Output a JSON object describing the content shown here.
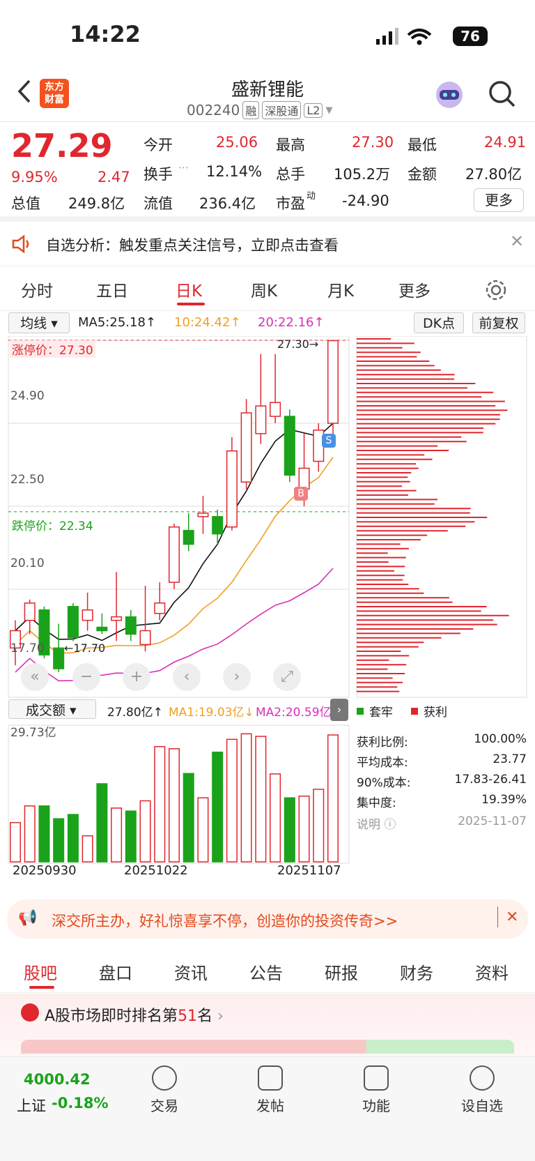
{
  "status": {
    "time": "14:22",
    "battery": "76"
  },
  "header": {
    "title": "盛新锂能",
    "code": "002240",
    "tags": [
      "融",
      "深股通",
      "L2"
    ]
  },
  "quote": {
    "price": "27.29",
    "pct": "9.95%",
    "chg": "2.47",
    "open_l": "今开",
    "open": "25.06",
    "high_l": "最高",
    "high": "27.30",
    "low_l": "最低",
    "low": "24.91",
    "turn_l": "换手",
    "turn": "12.14%",
    "vol_l": "总手",
    "vol": "105.2万",
    "amt_l": "金额",
    "amt": "27.80亿",
    "mcap_l": "总值",
    "mcap": "249.8亿",
    "float_l": "流值",
    "float": "236.4亿",
    "pe_l": "市盈",
    "pe_sup": "动",
    "pe": "-24.90",
    "more": "更多"
  },
  "banner": {
    "text": "自选分析：触发重点关注信号，立即点击查看"
  },
  "tabs": [
    "分时",
    "五日",
    "日K",
    "周K",
    "月K",
    "更多"
  ],
  "toolbar": {
    "ma_sel": "均线",
    "ma5": "MA5:25.18↑",
    "ma10": "10:24.42↑",
    "ma20": "20:22.16↑",
    "dk": "DK点",
    "adj": "前复权"
  },
  "kchart": {
    "y_labels": [
      "27.30",
      "24.90",
      "22.50",
      "20.10",
      "17.70"
    ],
    "limit_up": "涨停价：27.30",
    "limit_down": "跌停价：22.34",
    "high_mark": "27.30→",
    "low_mark": "←17.70",
    "sig_b": "B",
    "sig_s": "S"
  },
  "volbar": {
    "sel": "成交额",
    "cur": "27.80亿↑",
    "ma1": "MA1:19.03亿↓",
    "ma2": "MA2:20.59亿↑",
    "max": "29.73亿",
    "dates": [
      "20250930",
      "20251022",
      "20251107"
    ]
  },
  "chip": {
    "legend1": "套牢",
    "legend2": "获利",
    "rows": [
      {
        "k": "获利比例:",
        "v": "100.00%"
      },
      {
        "k": "平均成本:",
        "v": "23.77"
      },
      {
        "k": "90%成本:",
        "v": "17.83-26.41"
      },
      {
        "k": "集中度:",
        "v": "19.39%"
      }
    ],
    "note": "说明",
    "date": "2025-11-07"
  },
  "promo": {
    "text": "深交所主办，好礼惊喜享不停，创造你的投资传奇>>"
  },
  "btabs": [
    "股吧",
    "盘口",
    "资讯",
    "公告",
    "研报",
    "财务",
    "资料"
  ],
  "rank": {
    "pre": "A股市场即时排名第",
    "num": "51",
    "post": "名"
  },
  "bottom": {
    "index": "4000.42",
    "index_name": "上证",
    "index_chg": "-0.18%",
    "items": [
      "交易",
      "发帖",
      "功能",
      "设自选"
    ]
  },
  "colors": {
    "up": "#e0262f",
    "down": "#1aa31a",
    "ma10": "#f0a020",
    "ma20": "#d92fb8"
  },
  "chart_data": {
    "type": "candlestick",
    "dates_shown": [
      "20250930",
      "20251022",
      "20251107"
    ],
    "candles": [
      {
        "o": 18.4,
        "c": 18.9,
        "h": 19.2,
        "l": 17.9
      },
      {
        "o": 19.2,
        "c": 19.7,
        "h": 19.8,
        "l": 18.8
      },
      {
        "o": 19.5,
        "c": 18.2,
        "h": 19.6,
        "l": 18.1
      },
      {
        "o": 18.4,
        "c": 17.8,
        "h": 19.1,
        "l": 17.7
      },
      {
        "o": 19.6,
        "c": 18.7,
        "h": 19.7,
        "l": 18.6
      },
      {
        "o": 19.2,
        "c": 19.5,
        "h": 20.0,
        "l": 18.9
      },
      {
        "o": 19.0,
        "c": 18.9,
        "h": 19.4,
        "l": 18.8
      },
      {
        "o": 19.2,
        "c": 19.3,
        "h": 20.6,
        "l": 18.6
      },
      {
        "o": 19.3,
        "c": 18.8,
        "h": 19.5,
        "l": 18.6
      },
      {
        "o": 18.5,
        "c": 18.9,
        "h": 20.2,
        "l": 18.3
      },
      {
        "o": 19.4,
        "c": 19.7,
        "h": 20.3,
        "l": 19.2
      },
      {
        "o": 20.3,
        "c": 21.9,
        "h": 22.0,
        "l": 20.1
      },
      {
        "o": 21.8,
        "c": 21.4,
        "h": 22.3,
        "l": 21.2
      },
      {
        "o": 22.2,
        "c": 22.3,
        "h": 22.8,
        "l": 21.7
      },
      {
        "o": 22.2,
        "c": 21.7,
        "h": 22.4,
        "l": 21.4
      },
      {
        "o": 21.9,
        "c": 24.1,
        "h": 24.5,
        "l": 21.8
      },
      {
        "o": 23.2,
        "c": 25.2,
        "h": 25.6,
        "l": 23.0
      },
      {
        "o": 24.6,
        "c": 25.4,
        "h": 26.9,
        "l": 24.3
      },
      {
        "o": 25.1,
        "c": 25.5,
        "h": 26.9,
        "l": 24.9
      },
      {
        "o": 25.1,
        "c": 23.4,
        "h": 25.3,
        "l": 23.2
      },
      {
        "o": 23.0,
        "c": 23.6,
        "h": 24.6,
        "l": 22.5
      },
      {
        "o": 23.8,
        "c": 24.7,
        "h": 24.9,
        "l": 23.5
      },
      {
        "o": 24.9,
        "c": 27.29,
        "h": 27.3,
        "l": 24.6
      }
    ],
    "volume": [
      9.2,
      13.1,
      13.1,
      10.1,
      11.1,
      6.1,
      18.3,
      12.6,
      11.9,
      14.3,
      27.0,
      26.5,
      20.7,
      15.0,
      25.7,
      28.7,
      30.0,
      29.4,
      20.6,
      15.0,
      15.4,
      17.0,
      29.73
    ],
    "ylim": [
      17.7,
      27.3
    ],
    "vol_max": 29.73
  }
}
